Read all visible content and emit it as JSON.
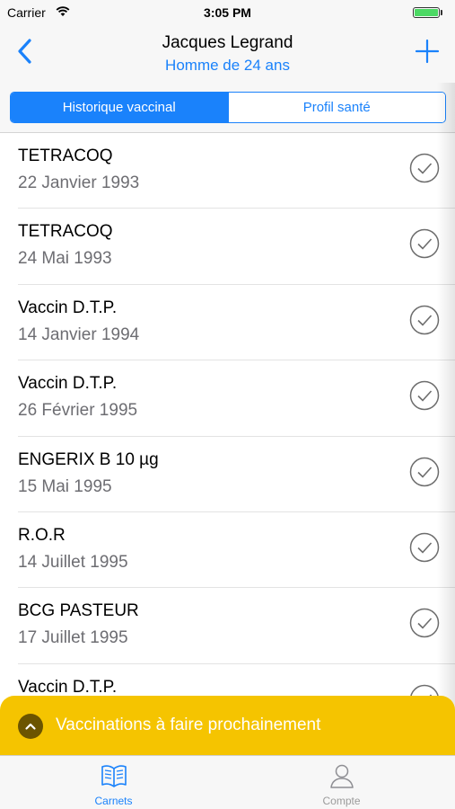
{
  "status_bar": {
    "carrier": "Carrier",
    "time": "3:05 PM",
    "battery_color": "#4cd964"
  },
  "nav": {
    "back_icon": "chevron-left-icon",
    "title": "Jacques Legrand",
    "subtitle": "Homme de 24 ans",
    "add_icon": "plus-icon",
    "accent": "#1a82fb"
  },
  "segments": {
    "active": "Historique vaccinal",
    "inactive": "Profil santé"
  },
  "vaccines": [
    {
      "name": "TETRACOQ",
      "date": "22 Janvier 1993"
    },
    {
      "name": "TETRACOQ",
      "date": "24 Mai 1993"
    },
    {
      "name": "Vaccin D.T.P.",
      "date": "14 Janvier 1994"
    },
    {
      "name": "Vaccin D.T.P.",
      "date": "26 Février 1995"
    },
    {
      "name": "ENGERIX B 10 µg",
      "date": "15 Mai 1995"
    },
    {
      "name": "R.O.R",
      "date": "14 Juillet 1995"
    },
    {
      "name": "BCG PASTEUR",
      "date": "17 Juillet 1995"
    },
    {
      "name": "Vaccin D.T.P.",
      "date": ""
    }
  ],
  "banner": {
    "text": "Vaccinations à faire prochainement",
    "color": "#f5c400",
    "icon": "chevron-up-icon"
  },
  "tabs": [
    {
      "label": "Carnets",
      "icon": "book-icon",
      "active": true
    },
    {
      "label": "Compte",
      "icon": "person-icon",
      "active": false
    }
  ]
}
